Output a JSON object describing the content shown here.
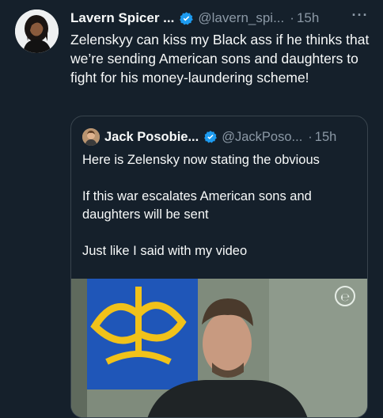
{
  "tweet": {
    "author_name": "Lavern Spicer ...",
    "author_handle": "@lavern_spi...",
    "separator": "·",
    "time": "15h",
    "more_label": "···",
    "text": "Zelenskyy can kiss my Black ass if he thinks that we’re sending American sons and daughters to fight for his money-laundering scheme!"
  },
  "quote": {
    "author_name": "Jack Posobie...",
    "author_handle": "@JackPoso...",
    "separator": "·",
    "time": "15h",
    "paragraphs": [
      "Here is Zelensky now stating the obvious",
      "If this war escalates American sons and daughters will be sent",
      "Just like I said with my video"
    ],
    "media_watermark": "℮"
  },
  "colors": {
    "background": "#15202b",
    "text": "#f7f9f9",
    "muted": "#8b98a5",
    "verified": "#1d9bf0",
    "border": "#38444d"
  },
  "icons": [
    "verified-badge-icon",
    "more-options-icon"
  ]
}
